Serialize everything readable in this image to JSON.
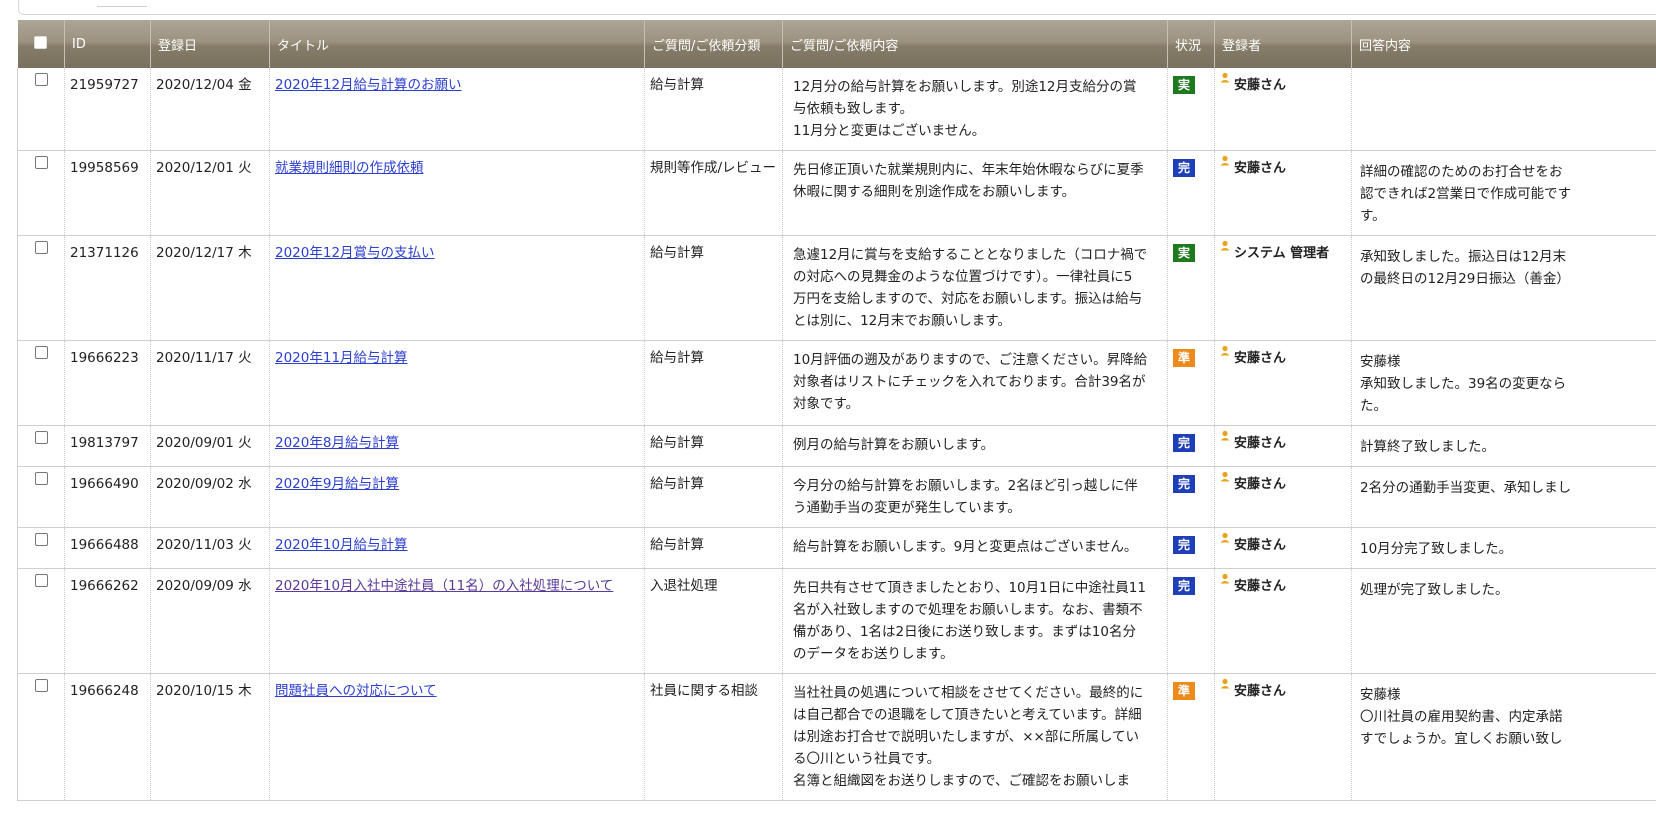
{
  "columns": {
    "id": "ID",
    "date": "登録日",
    "title": "タイトル",
    "category": "ご質問/ご依頼分類",
    "content": "ご質問/ご依頼内容",
    "status": "状況",
    "user": "登録者",
    "answer": "回答内容"
  },
  "colors": {
    "header_bg": "#968c79",
    "status_green": "#1f7a1f",
    "status_blue": "#1f3fb8",
    "status_orange": "#ee8a1c",
    "link": "#2b3fd0"
  },
  "rows": [
    {
      "id": "21959727",
      "date": "2020/12/04 金",
      "title": "2020年12月給与計算のお願い",
      "category": "給与計算",
      "content": "12月分の給与計算をお願いします。別途12月支給分の賞\n与依頼も致します。\n11月分と変更はございません。",
      "status": "実",
      "status_color": "green",
      "user": "安藤さん",
      "answer": ""
    },
    {
      "id": "19958569",
      "date": "2020/12/01 火",
      "title": "就業規則細則の作成依頼",
      "category": "規則等作成/レビュー",
      "content": "先日修正頂いた就業規則内に、年末年始休暇ならびに夏季\n休暇に関する細則を別途作成をお願いします。",
      "status": "完",
      "status_color": "blue",
      "user": "安藤さん",
      "answer": "詳細の確認のためのお打合せをお\n認できれば2営業日で作成可能です\nす。"
    },
    {
      "id": "21371126",
      "date": "2020/12/17 木",
      "title": "2020年12月賞与の支払い",
      "category": "給与計算",
      "content": "急遽12月に賞与を支給することとなりました（コロナ禍で\nの対応への見舞金のような位置づけです）。一律社員に5\n万円を支給しますので、対応をお願いします。振込は給与\nとは別に、12月末でお願いします。",
      "status": "実",
      "status_color": "green",
      "user": "システム 管理者",
      "answer": "承知致しました。振込日は12月末\nの最終日の12月29日振込（善金）"
    },
    {
      "id": "19666223",
      "date": "2020/11/17 火",
      "title": "2020年11月給与計算",
      "category": "給与計算",
      "content": "10月評価の遡及がありますので、ご注意ください。昇降給\n対象者はリストにチェックを入れております。合計39名が\n対象です。",
      "status": "準",
      "status_color": "orange",
      "user": "安藤さん",
      "answer": "安藤様\n承知致しました。39名の変更なら\nた。"
    },
    {
      "id": "19813797",
      "date": "2020/09/01 火",
      "title": "2020年8月給与計算",
      "category": "給与計算",
      "content": "例月の給与計算をお願いします。",
      "status": "完",
      "status_color": "blue",
      "user": "安藤さん",
      "answer": "計算終了致しました。"
    },
    {
      "id": "19666490",
      "date": "2020/09/02 水",
      "title": "2020年9月給与計算",
      "category": "給与計算",
      "content": "今月分の給与計算をお願いします。2名ほど引っ越しに伴\nう通勤手当の変更が発生しています。",
      "status": "完",
      "status_color": "blue",
      "user": "安藤さん",
      "answer": "2名分の通勤手当変更、承知しまし"
    },
    {
      "id": "19666488",
      "date": "2020/11/03 火",
      "title": "2020年10月給与計算",
      "category": "給与計算",
      "content": "給与計算をお願いします。9月と変更点はございません。",
      "status": "完",
      "status_color": "blue",
      "user": "安藤さん",
      "answer": "10月分完了致しました。"
    },
    {
      "id": "19666262",
      "date": "2020/09/09 水",
      "title": "2020年10月入社中途社員（11名）の入社処理について",
      "category": "入退社処理",
      "content": "先日共有させて頂きましたとおり、10月1日に中途社員11\n名が入社致しますので処理をお願いします。なお、書類不\n備があり、1名は2日後にお送り致します。まずは10名分\nのデータをお送りします。",
      "status": "完",
      "status_color": "blue",
      "user": "安藤さん",
      "answer": "処理が完了致しました。"
    },
    {
      "id": "19666248",
      "date": "2020/10/15 木",
      "title": "問題社員への対応について",
      "category": "社員に関する相談",
      "content": "当社社員の処遇について相談をさせてください。最終的に\nは自己都合での退職をして頂きたいと考えています。詳細\nは別途お打合せで説明いたしますが、××部に所属してい\nる〇川という社員です。\n名簿と組織図をお送りしますので、ご確認をお願いしま",
      "status": "準",
      "status_color": "orange",
      "user": "安藤さん",
      "answer": "安藤様\n〇川社員の雇用契約書、内定承諾\nすでしょうか。宜しくお願い致し"
    }
  ]
}
